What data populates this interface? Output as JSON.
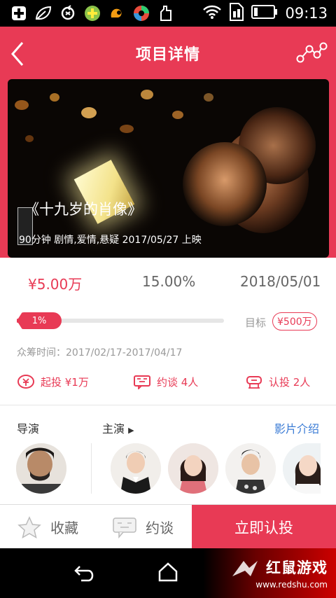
{
  "status_bar": {
    "time": "09:13"
  },
  "header": {
    "title": "项目详情"
  },
  "banner": {
    "title": "《十九岁的肖像》",
    "meta": "90分钟 剧情,爱情,悬疑 2017/05/27 上映"
  },
  "stats": {
    "amount": "¥5.00万",
    "rate": "15.00%",
    "date": "2018/05/01",
    "progress_label": "1%",
    "progress_fraction": 0.01,
    "target_label": "目标",
    "target_value": "¥500万",
    "period": "众筹时间：2017/02/17-2017/04/17"
  },
  "actions": {
    "min_invest": "起投 ¥1万",
    "talks": "约谈 4人",
    "investors": "认投 2人"
  },
  "crew": {
    "director_label": "导演",
    "cast_label": "主演",
    "intro_link": "影片介绍"
  },
  "action_bar": {
    "favorite": "收藏",
    "talk": "约谈",
    "invest": "立即认投"
  },
  "watermark": {
    "brand": "红鼠游戏",
    "url": "www.redshu.com"
  },
  "colors": {
    "accent": "#e83a55",
    "link": "#3a7bd5"
  }
}
